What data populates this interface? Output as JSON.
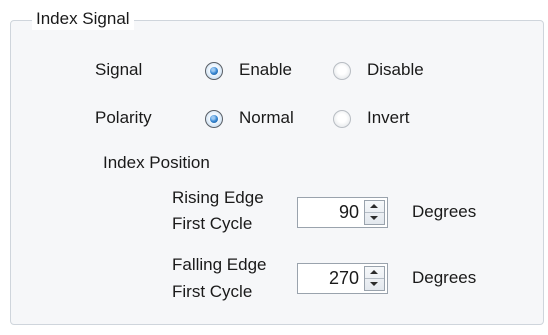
{
  "group": {
    "title": "Index Signal"
  },
  "signal": {
    "label": "Signal",
    "options": [
      "Enable",
      "Disable"
    ],
    "selected": "Enable"
  },
  "polarity": {
    "label": "Polarity",
    "options": [
      "Normal",
      "Invert"
    ],
    "selected": "Normal"
  },
  "index_position": {
    "heading": "Index Position",
    "rising": {
      "label_line1": "Rising Edge",
      "label_line2": "First Cycle",
      "value": "90",
      "unit": "Degrees"
    },
    "falling": {
      "label_line1": "Falling Edge",
      "label_line2": "First Cycle",
      "value": "270",
      "unit": "Degrees"
    }
  }
}
